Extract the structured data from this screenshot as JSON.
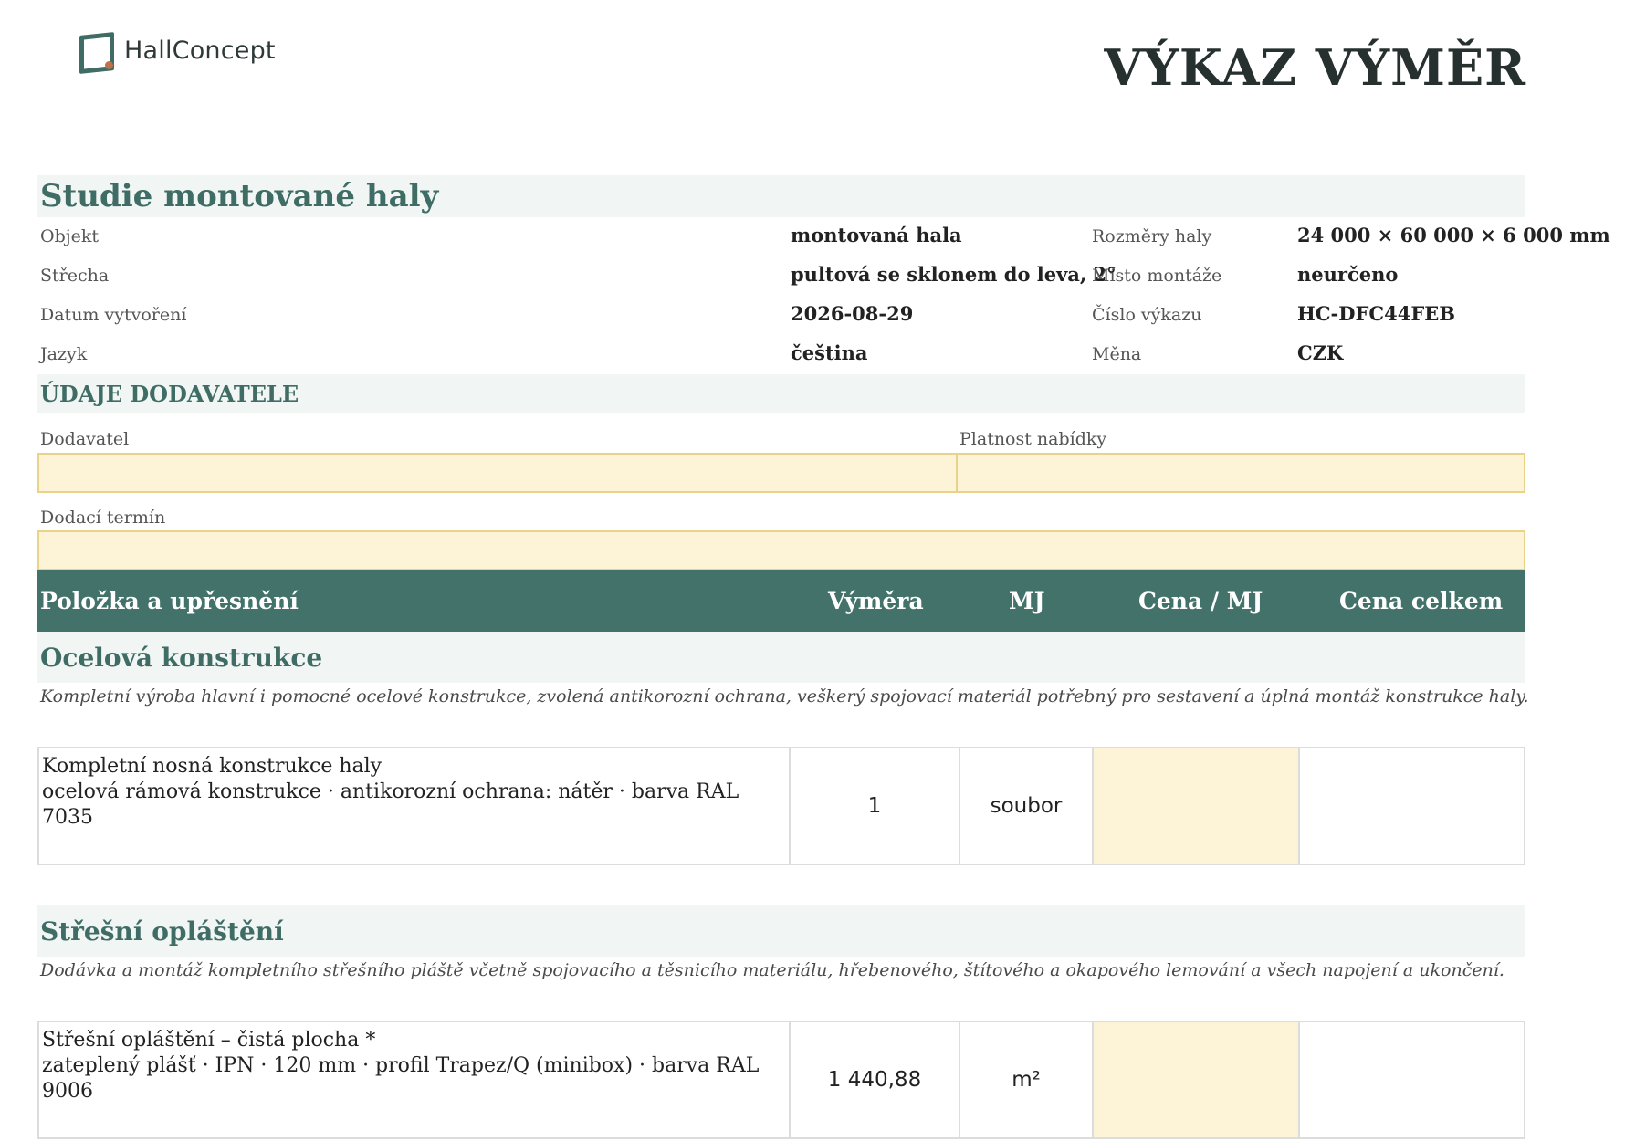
{
  "header": {
    "brand": "HallConcept",
    "title": "VÝKAZ VÝMĚR"
  },
  "project": {
    "title": "Studie montované haly",
    "info": [
      {
        "label": "Objekt",
        "value": "montovaná hala",
        "label2": "Rozměry haly",
        "value2": "24 000 × 60 000 × 6 000 mm"
      },
      {
        "label": "Střecha",
        "value": "pultová se sklonem do leva, 2°",
        "label2": "Místo montáže",
        "value2": "neurčeno"
      },
      {
        "label": "Datum vytvoření",
        "value": "2026-08-29",
        "label2": "Číslo výkazu",
        "value2": "HC-DFC44FEB"
      },
      {
        "label": "Jazyk",
        "value": "čeština",
        "label2": "Měna",
        "value2": "CZK"
      }
    ]
  },
  "supplier": {
    "heading": "ÚDAJE DODAVATELE",
    "supplier_label": "Dodavatel",
    "supplier_value": "",
    "validity_label": "Platnost nabídky",
    "validity_value": "",
    "delivery_label": "Dodací termín",
    "delivery_value": ""
  },
  "table": {
    "columns": [
      "Položka a upřesnění",
      "Výměra",
      "MJ",
      "Cena / MJ",
      "Cena celkem"
    ],
    "categories": [
      {
        "name": "Ocelová konstrukce",
        "description": "Kompletní výroba hlavní i pomocné ocelové konstrukce, zvolená antikorozní ochrana, veškerý spojovací materiál potřebný pro sestavení a úplná montáž konstrukce haly.",
        "items": [
          {
            "title": "Kompletní nosná konstrukce haly",
            "spec": "ocelová rámová konstrukce · antikorozní ochrana: nátěr · barva RAL 7035",
            "qty": "1",
            "unit": "soubor",
            "unit_price": "",
            "total": ""
          }
        ]
      },
      {
        "name": "Střešní opláštění",
        "description": "Dodávka a montáž kompletního střešního pláště včetně spojovacího a těsnicího materiálu, hřebenového, štítového a okapového lemování a všech napojení a ukončení.",
        "items": [
          {
            "title": "Střešní opláštění – čistá plocha *",
            "spec": "zateplený plášť · IPN · 120 mm · profil Trapez/Q (minibox) · barva RAL 9006",
            "qty": "1 440,88",
            "unit": "m²",
            "unit_price": "",
            "total": ""
          }
        ]
      }
    ]
  }
}
